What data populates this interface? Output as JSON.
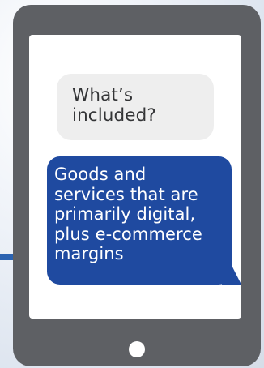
{
  "conversation": {
    "question_lines": [
      "What’s",
      "included?"
    ],
    "answer_lines": [
      "Goods and",
      "services that are",
      "primarily digital,",
      "plus e-commerce",
      "margins"
    ]
  },
  "colors": {
    "tablet_frame": "#5e6064",
    "question_bubble": "#eeeeee",
    "answer_bubble": "#1f4aa0",
    "accent_line": "#2b63b1"
  },
  "icons": {
    "home_button": "home-button-icon"
  }
}
